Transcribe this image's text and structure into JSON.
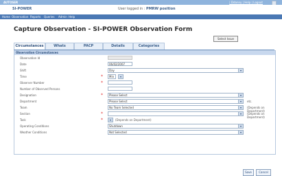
{
  "topbar": {
    "brand": "AUTOSER",
    "links": "| Ddanny | Help | Logout"
  },
  "header": {
    "app_name": "SI-POWER",
    "login_prefix": "User logged in : ",
    "login_user": "PMRW position"
  },
  "nav": {
    "items": [
      "Home",
      "Observation",
      "Reports",
      "Queries",
      "Admin",
      "Help"
    ]
  },
  "page": {
    "title": "Capture Observation - SI-POWER Observation Form",
    "select_issue": "Select Issue"
  },
  "tabs": [
    "Circumstances",
    "Whats",
    "PACP",
    "Details",
    "Categories"
  ],
  "section": {
    "heading": "Observation Circumstances"
  },
  "fields": {
    "observation_id": {
      "label": "Observation Id",
      "value": ""
    },
    "date": {
      "label": "Date",
      "value": "06/02/2007"
    },
    "shift": {
      "label": "Shift",
      "value": "Day"
    },
    "time": {
      "label": "Time",
      "value": "Min"
    },
    "observer_number": {
      "label": "Observer Number",
      "value": ""
    },
    "num_observed": {
      "label": "Number of Observed Persons",
      "value": ""
    },
    "designation": {
      "label": "Designation",
      "value": "Please Select"
    },
    "department": {
      "label": "Department",
      "value": "Please Select",
      "hint": "etc."
    },
    "team": {
      "label": "Team",
      "value": "No Team Selected",
      "hint": "(Depends on Department)"
    },
    "section": {
      "label": "Section",
      "value": "",
      "hint": "(Depends on Department)"
    },
    "task": {
      "label": "Task",
      "value": "",
      "hint": "(Depends on Department)"
    },
    "operating_conditions": {
      "label": "Operating Conditions",
      "value": "Shutdown"
    },
    "weather_conditions": {
      "label": "Weather Conditions",
      "value": "Not Selected"
    }
  },
  "buttons": {
    "save": "Save",
    "cancel": "Cancel"
  }
}
